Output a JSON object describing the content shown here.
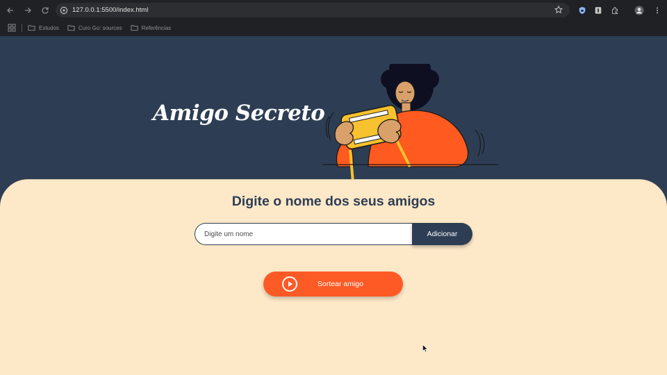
{
  "browser": {
    "url": "127.0.0.1:5500/index.html",
    "bookmarks": [
      {
        "label": "Estudos"
      },
      {
        "label": "Curo Go: sources"
      },
      {
        "label": "Referências"
      }
    ]
  },
  "page": {
    "title": "Amigo Secreto",
    "heading": "Digite o nome dos seus amigos",
    "name_input": {
      "placeholder": "Digite um nome",
      "value": ""
    },
    "add_button": "Adicionar",
    "draw_button": "Sortear amigo"
  },
  "colors": {
    "header_bg": "#2d3e54",
    "card_bg": "#fde8c8",
    "accent_orange": "#fe5a26",
    "illustration_yellow": "#f7c22f"
  },
  "icons": [
    "back-icon",
    "forward-icon",
    "reload-icon",
    "site-info-icon",
    "star-icon",
    "apps-icon",
    "folder-icon",
    "play-icon",
    "profile-icon",
    "menu-icon"
  ]
}
